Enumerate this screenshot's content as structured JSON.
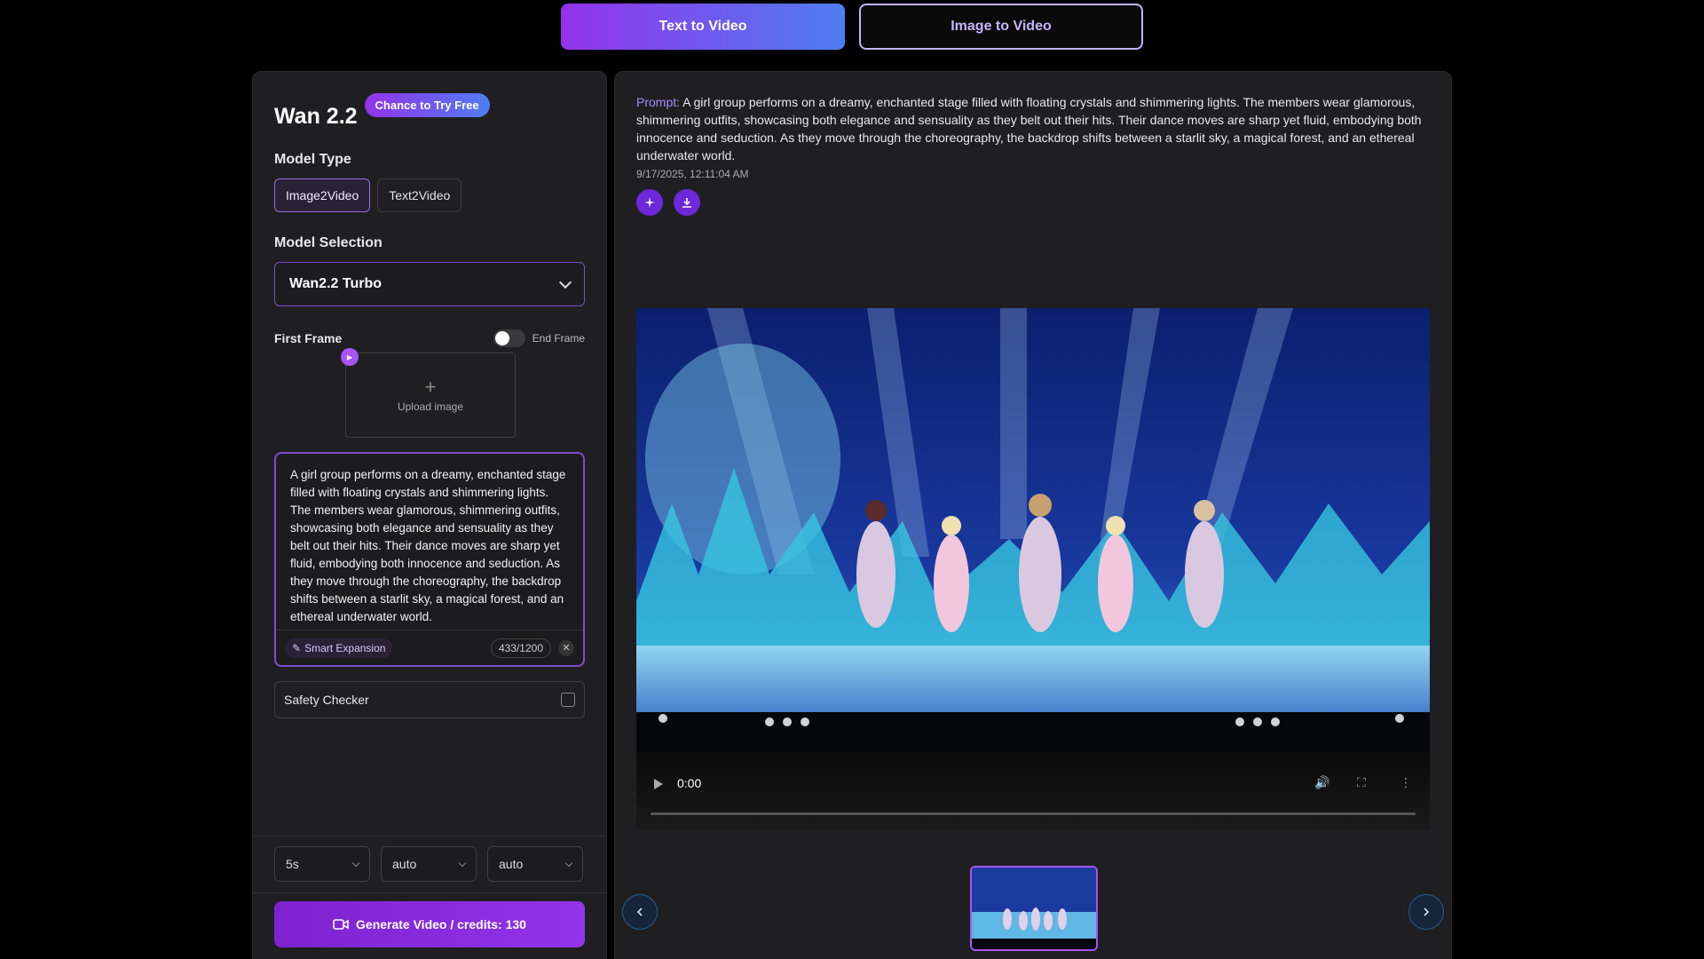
{
  "mode_tabs": [
    {
      "label": "Text to Video",
      "active": true
    },
    {
      "label": "Image to Video",
      "active": false
    }
  ],
  "left": {
    "title": "Wan 2.2",
    "free_badge": "Chance to Try Free",
    "model_type_label": "Model Type",
    "model_types": [
      "Image2Video",
      "Text2Video"
    ],
    "model_selection_label": "Model Selection",
    "model_selected": "Wan2.2 Turbo",
    "first_frame_label": "First Frame",
    "end_frame_label": "End Frame",
    "upload_label": "Upload image",
    "prompt_text": "A girl group performs on a dreamy, enchanted stage filled with floating crystals and shimmering lights. The members wear glamorous, shimmering outfits, showcasing both elegance and sensuality as they belt out their hits. Their dance moves are sharp yet fluid, embodying both innocence and seduction. As they move through the choreography, the backdrop shifts between a starlit sky, a magical forest, and an ethereal underwater world.",
    "smart_expansion": "Smart Expansion",
    "char_count": "433/1200",
    "safety_checker": "Safety Checker",
    "duration": "5s",
    "resolution": "auto",
    "aspect": "auto",
    "generate_label": "Generate Video /  credits: 130"
  },
  "right": {
    "prompt_label": "Prompt:",
    "prompt_text": "A girl group performs on a dreamy, enchanted stage filled with floating crystals and shimmering lights. The members wear glamorous, shimmering outfits, showcasing both elegance and sensuality as they belt out their hits. Their dance moves are sharp yet fluid, embodying both innocence and seduction. As they move through the choreography, the backdrop shifts between a starlit sky, a magical forest, and an ethereal underwater world.",
    "timestamp": "9/17/2025, 12:11:04 AM",
    "video_time": "0:00"
  },
  "colors": {
    "accent": "#9333ea",
    "accent_blue": "#4f7df3",
    "panel_bg": "#1f1f21"
  }
}
